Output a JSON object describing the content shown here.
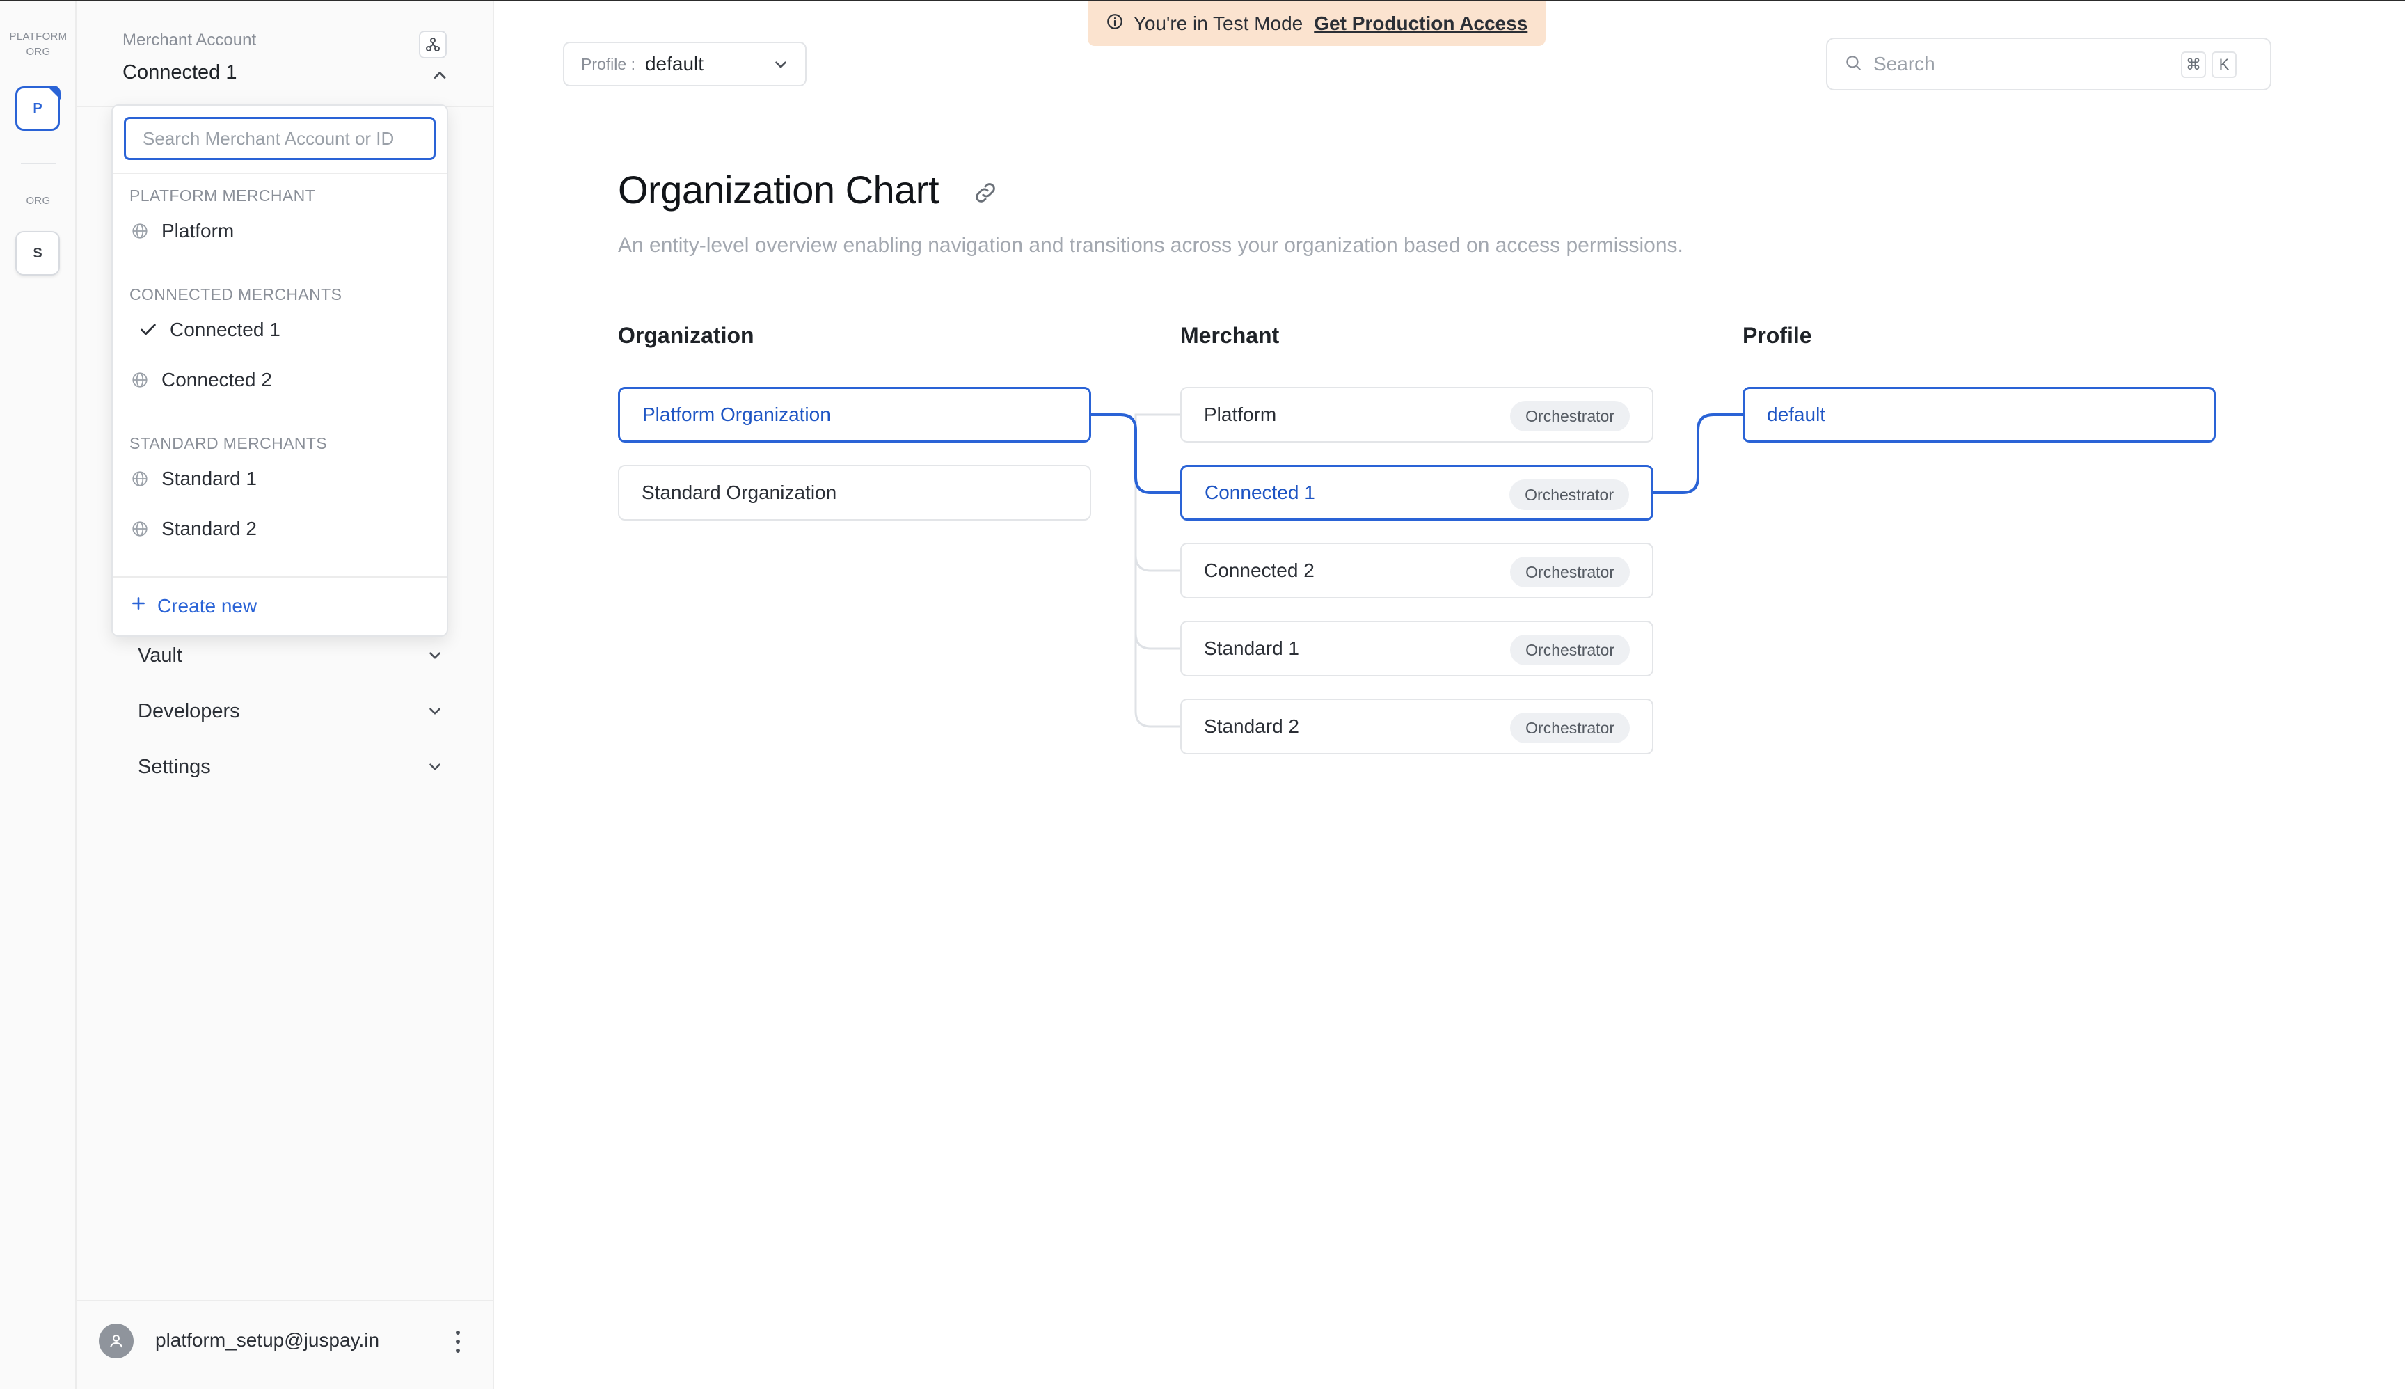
{
  "org_rail": {
    "header": [
      "PLATFORM",
      "ORG"
    ],
    "tiles": [
      {
        "initial": "P",
        "active": true
      },
      {
        "section_label": "ORG",
        "initial": "S",
        "active": false
      }
    ]
  },
  "sidebar": {
    "account_label": "Merchant Account",
    "account_value": "Connected 1",
    "nav_items": [
      {
        "label": "Vault"
      },
      {
        "label": "Developers"
      },
      {
        "label": "Settings"
      }
    ],
    "user_email": "platform_setup@juspay.in"
  },
  "dropdown": {
    "search_placeholder": "Search Merchant Account or ID",
    "groups": [
      {
        "label": "PLATFORM MERCHANT",
        "items": [
          {
            "label": "Platform",
            "selected": false
          }
        ]
      },
      {
        "label": "CONNECTED MERCHANTS",
        "items": [
          {
            "label": "Connected 1",
            "selected": true
          },
          {
            "label": "Connected 2",
            "selected": false
          }
        ]
      },
      {
        "label": "STANDARD MERCHANTS",
        "items": [
          {
            "label": "Standard 1",
            "selected": false
          },
          {
            "label": "Standard 2",
            "selected": false
          }
        ]
      }
    ],
    "create_label": "Create new"
  },
  "topbar": {
    "banner_text": "You're in Test Mode",
    "banner_link": "Get Production Access",
    "profile_label": "Profile :",
    "profile_value": "default",
    "search_placeholder": "Search",
    "shortcut_keys": [
      "⌘",
      "K"
    ]
  },
  "page": {
    "title": "Organization Chart",
    "description": "An entity-level overview enabling navigation and transitions across your organization based on access permissions."
  },
  "org_chart": {
    "columns": [
      {
        "title": "Organization",
        "nodes": [
          {
            "label": "Platform Organization",
            "selected": true
          },
          {
            "label": "Standard Organization",
            "selected": false
          }
        ]
      },
      {
        "title": "Merchant",
        "nodes": [
          {
            "label": "Platform",
            "badge": "Orchestrator",
            "selected": false
          },
          {
            "label": "Connected 1",
            "badge": "Orchestrator",
            "selected": true
          },
          {
            "label": "Connected 2",
            "badge": "Orchestrator",
            "selected": false
          },
          {
            "label": "Standard 1",
            "badge": "Orchestrator",
            "selected": false
          },
          {
            "label": "Standard 2",
            "badge": "Orchestrator",
            "selected": false
          }
        ]
      },
      {
        "title": "Profile",
        "nodes": [
          {
            "label": "default",
            "selected": true
          }
        ]
      }
    ]
  },
  "colors": {
    "accent": "#2a63d6",
    "banner_bg": "#fbe3cf",
    "muted_text": "#8a8f98"
  }
}
